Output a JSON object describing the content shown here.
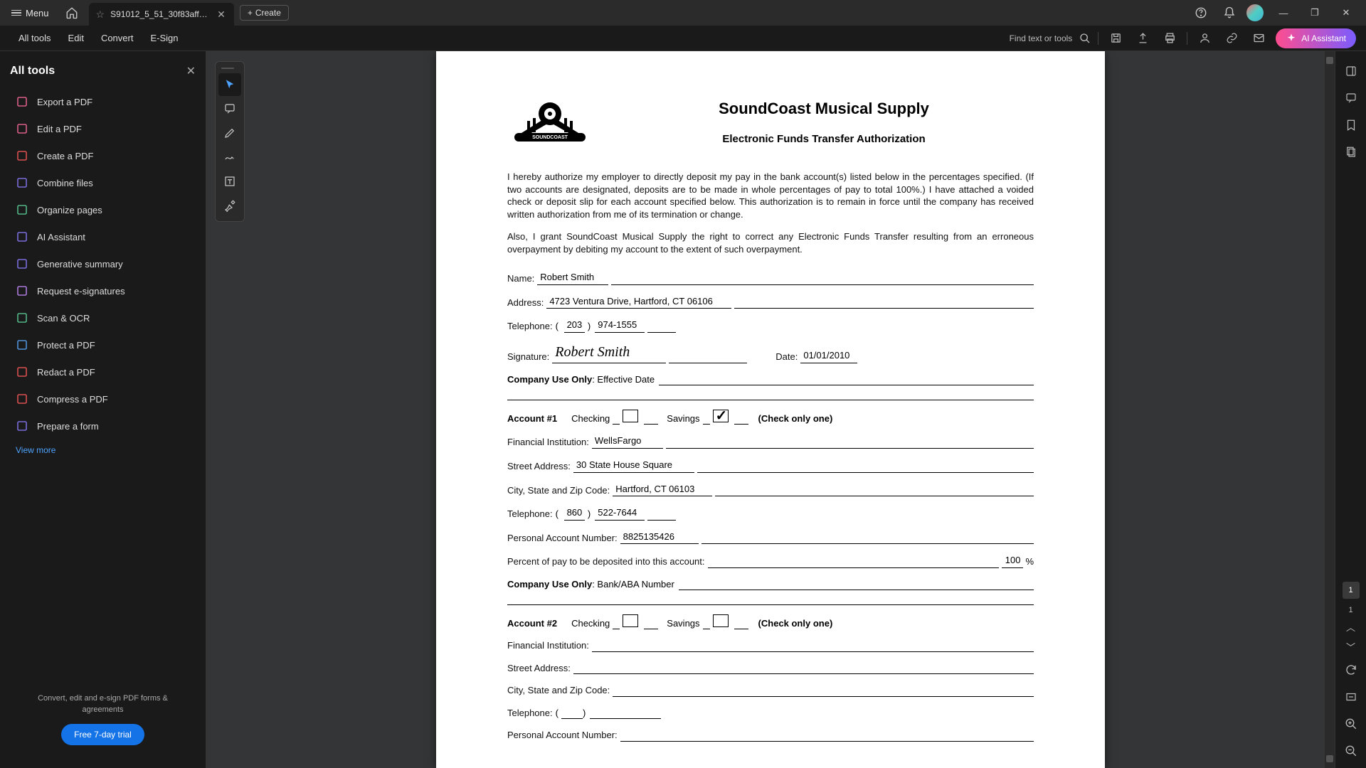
{
  "titlebar": {
    "menu": "Menu",
    "tab": "S91012_5_51_30f83aff-c...",
    "create": "Create"
  },
  "toolbar": {
    "all_tools": "All tools",
    "edit": "Edit",
    "convert": "Convert",
    "esign": "E-Sign",
    "find": "Find text or tools",
    "ai": "AI Assistant"
  },
  "sidebar": {
    "title": "All tools",
    "items": [
      {
        "label": "Export a PDF",
        "color": "#ff6b9d"
      },
      {
        "label": "Edit a PDF",
        "color": "#ff6b9d"
      },
      {
        "label": "Create a PDF",
        "color": "#ff5a5a"
      },
      {
        "label": "Combine files",
        "color": "#8b7cff"
      },
      {
        "label": "Organize pages",
        "color": "#5dd39e"
      },
      {
        "label": "AI Assistant",
        "color": "#8b7cff"
      },
      {
        "label": "Generative summary",
        "color": "#8b7cff"
      },
      {
        "label": "Request e-signatures",
        "color": "#c58bff"
      },
      {
        "label": "Scan & OCR",
        "color": "#5dd39e"
      },
      {
        "label": "Protect a PDF",
        "color": "#5aa9ff"
      },
      {
        "label": "Redact a PDF",
        "color": "#ff5a5a"
      },
      {
        "label": "Compress a PDF",
        "color": "#ff5a5a"
      },
      {
        "label": "Prepare a form",
        "color": "#8b7cff"
      }
    ],
    "view_more": "View more",
    "footer": "Convert, edit and e-sign PDF forms & agreements",
    "trial": "Free 7-day trial"
  },
  "right_rail": {
    "page_current": "1",
    "page_total": "1"
  },
  "doc": {
    "company": "SoundCoast Musical Supply",
    "subtitle": "Electronic Funds Transfer Authorization",
    "para1": "I hereby authorize my employer to directly deposit my pay in the bank account(s) listed below in the percentages specified.  (If two accounts are designated, deposits are to be made in whole percentages of pay to total 100%.)  I have attached a voided check or deposit slip for each account specified below.  This authorization is to remain in force until the company has received written authorization from me of its termination or change.",
    "para2": "Also, I grant SoundCoast Musical Supply the right to correct any Electronic Funds Transfer resulting from an erroneous overpayment by debiting my account to the extent of such overpayment.",
    "labels": {
      "name": "Name:",
      "address": "Address:",
      "telephone": "Telephone:",
      "signature": "Signature:",
      "date": "Date:",
      "company_use": "Company Use Only",
      "effective": ": Effective Date",
      "acct1": "Account #1",
      "acct2": "Account #2",
      "checking": "Checking",
      "savings": "Savings",
      "check_one": "(Check only one)",
      "fin": "Financial Institution:",
      "street": "Street Address:",
      "city": "City, State and Zip Code:",
      "pan": "Personal Account Number:",
      "pct": "Percent of pay to be deposited into this account:",
      "aba": ": Bank/ABA Number"
    },
    "values": {
      "name": "Robert Smith",
      "address": "4723 Ventura Drive, Hartford, CT 06106",
      "tel_area": "203",
      "tel_num": "974-1555",
      "signature": "Robert Smith",
      "date": "01/01/2010",
      "a1_fin": "WellsFargo",
      "a1_street": "30 State House Square",
      "a1_city": "Hartford, CT 06103",
      "a1_tel_area": "860",
      "a1_tel_num": "522-7644",
      "a1_pan": "8825135426",
      "a1_pct": "100"
    }
  }
}
